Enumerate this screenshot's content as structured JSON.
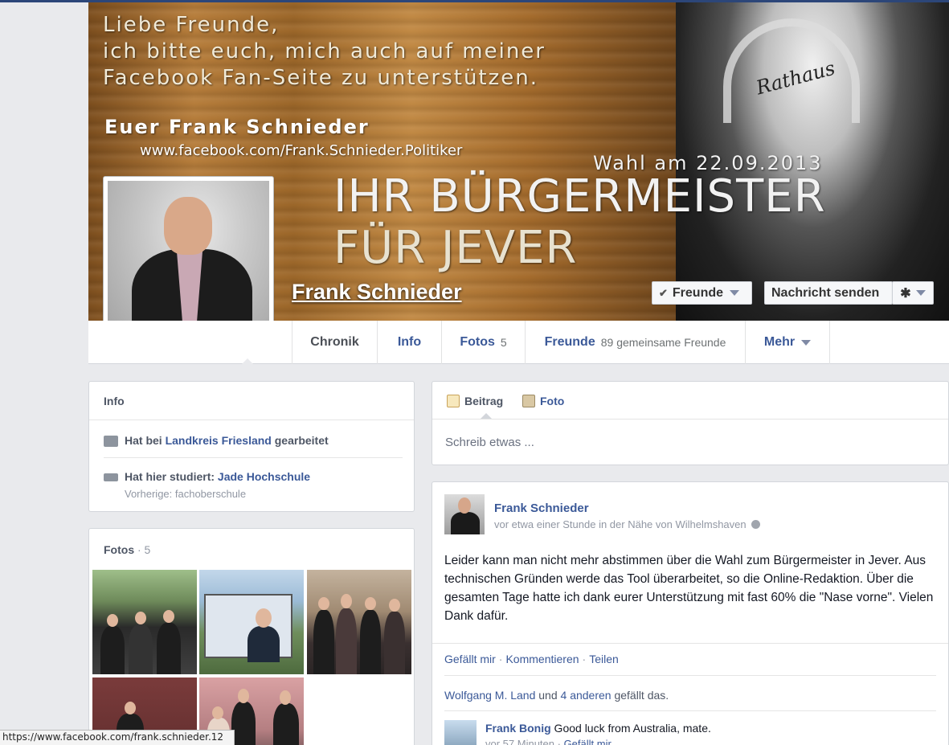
{
  "cover": {
    "greeting_line1": "Liebe Freunde,",
    "greeting_line2": "ich bitte euch, mich auch auf meiner",
    "greeting_line3": "Facebook Fan-Seite zu unterstützen.",
    "signature": "Euer Frank Schnieder",
    "fanpage_url": "www.facebook.com/Frank.Schnieder.Politiker",
    "election_date": "Wahl am 22.09.2013",
    "headline1": "IHR BÜRGERMEISTER",
    "headline2": "FÜR JEVER",
    "building_sign": "Rathaus"
  },
  "profile": {
    "name": "Frank Schnieder"
  },
  "actions": {
    "friends_label": "Freunde",
    "message_label": "Nachricht senden",
    "settings_glyph": "✱"
  },
  "tabs": {
    "chronik": "Chronik",
    "info": "Info",
    "fotos": "Fotos",
    "fotos_count": "5",
    "freunde": "Freunde",
    "freunde_count": "89 gemeinsame Freunde",
    "mehr": "Mehr"
  },
  "info_card": {
    "title": "Info",
    "work_prefix": "Hat bei",
    "work_place": "Landkreis Friesland",
    "work_suffix": "gearbeitet",
    "study_prefix": "Hat hier studiert:",
    "study_place": "Jade Hochschule",
    "previous": "Vorherige: fachoberschule"
  },
  "fotos_card": {
    "title": "Fotos",
    "count": " · 5"
  },
  "composer": {
    "tab_post": "Beitrag",
    "tab_photo": "Foto",
    "placeholder": "Schreib etwas ..."
  },
  "post": {
    "author": "Frank Schnieder",
    "meta": "vor etwa einer Stunde in der Nähe von Wilhelmshaven",
    "text": "Leider kann man nicht mehr abstimmen über die Wahl zum Bürgermeister in Jever. Aus technischen Gründen werde das Tool überarbeitet, so die Online-Redaktion. Über die gesamten Tage hatte ich dank eurer Unterstützung mit fast 60% die \"Nase vorne\". Vielen Dank dafür.",
    "like": "Gefällt mir",
    "comment": "Kommentieren",
    "share": "Teilen",
    "likers": "Wolfgang M. Land",
    "likers_and": " und ",
    "likers_others": "4 anderen",
    "likers_suffix": " gefällt das."
  },
  "comment": {
    "author": "Frank Bonig",
    "text": " Good luck from Australia, mate.",
    "time": "vor 57 Minuten",
    "like": "Gefällt mir"
  },
  "statusbar": {
    "url": "https://www.facebook.com/frank.schnieder.12"
  }
}
